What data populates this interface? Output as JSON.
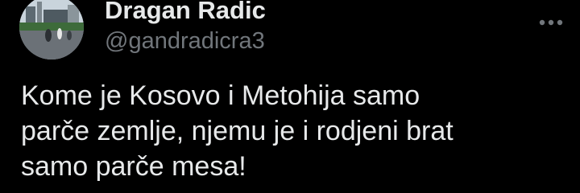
{
  "author": {
    "display_name": "Dragan Radic",
    "handle": "@gandradicra3",
    "avatar_icon": "profile-photo"
  },
  "tweet": {
    "text_lines": [
      "Kome je Kosovo i Metohija samo",
      "parče zemlje, njemu je i rodjeni brat",
      "samo parče mesa!"
    ]
  },
  "menu": {
    "icon": "more-horizontal-icon"
  },
  "colors": {
    "background": "#000000",
    "primary_text": "#e7e9ea",
    "secondary_text": "#71767b"
  }
}
